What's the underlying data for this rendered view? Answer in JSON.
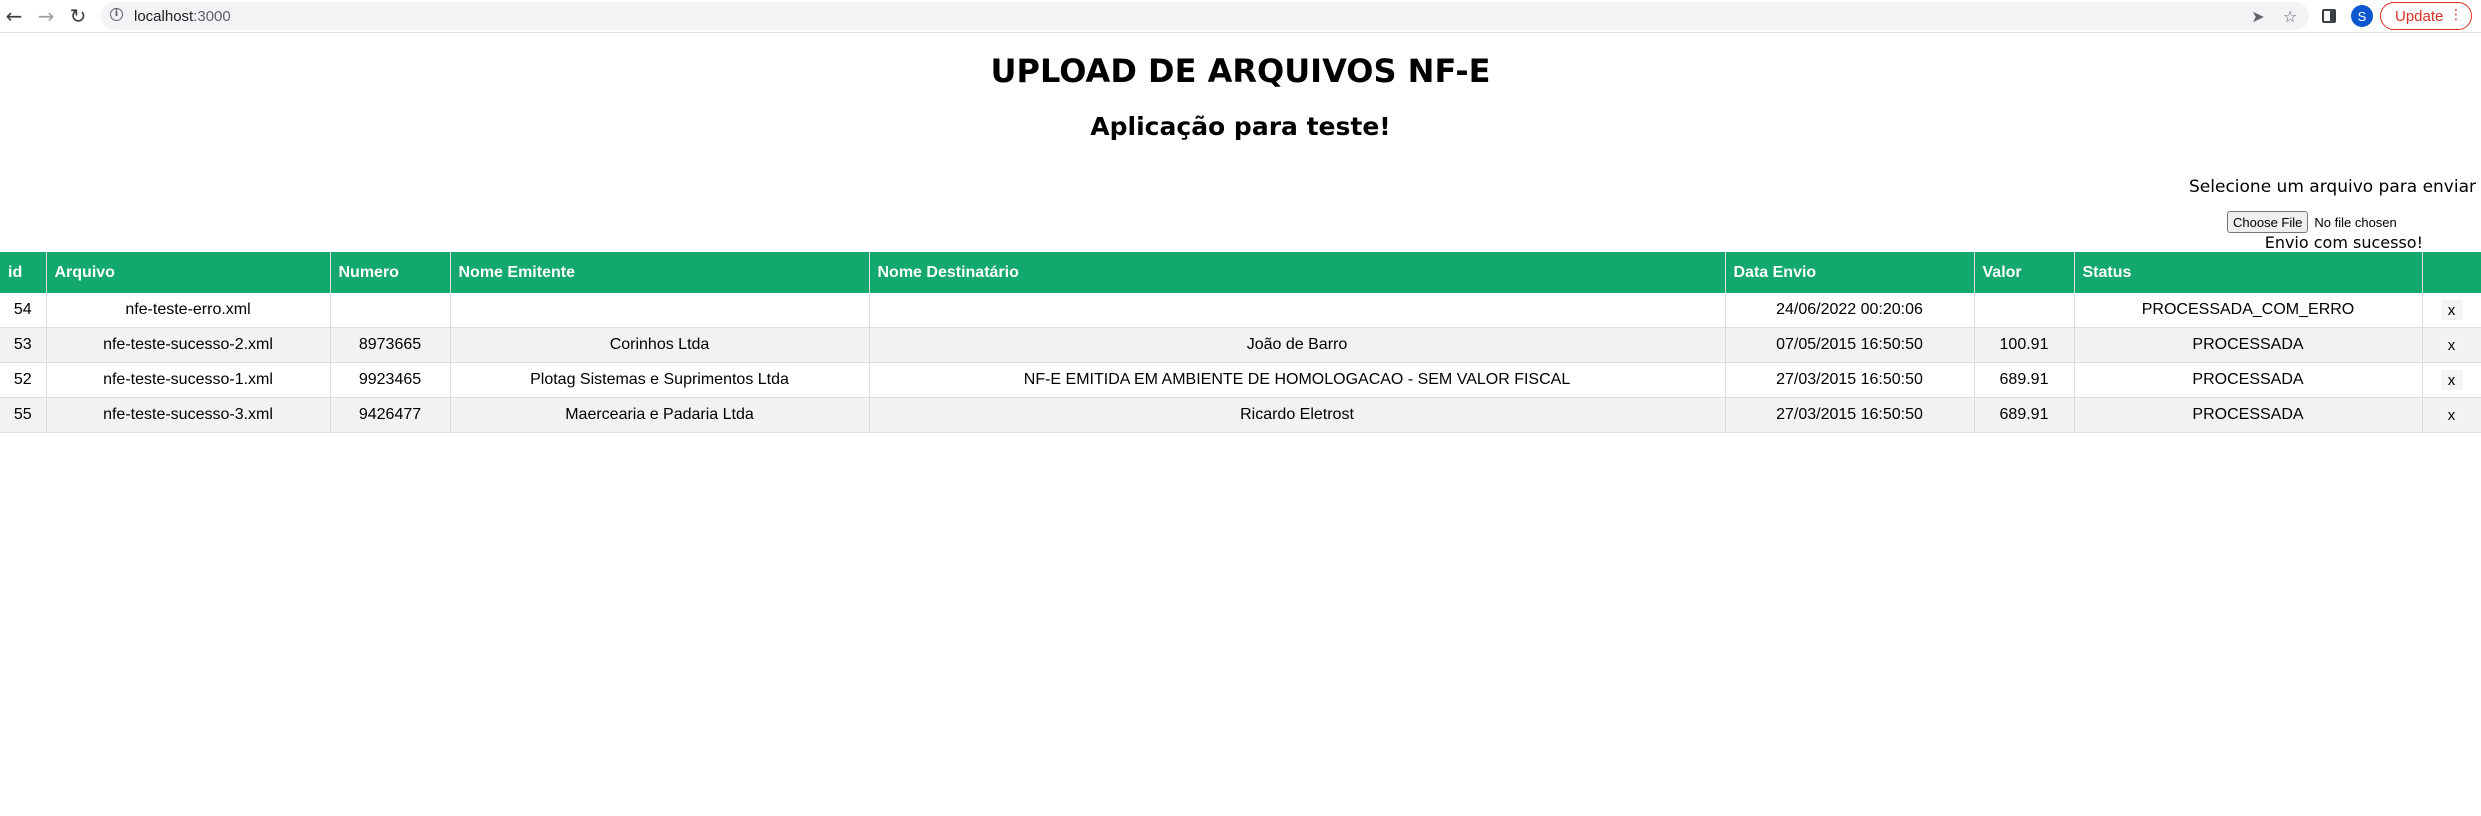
{
  "browser": {
    "url_host": "localhost",
    "url_port": ":3000",
    "profile_initial": "S",
    "update_label": "Update"
  },
  "page": {
    "title": "UPLOAD DE ARQUIVOS NF-E",
    "subtitle": "Aplicação para teste!"
  },
  "upload": {
    "label": "Selecione um arquivo para enviar",
    "button_label": "Choose File",
    "file_status": "No file chosen",
    "message": "Envio com sucesso!"
  },
  "table": {
    "headers": [
      "id",
      "Arquivo",
      "Numero",
      "Nome Emitente",
      "Nome Destinatário",
      "Data Envio",
      "Valor",
      "Status",
      ""
    ],
    "rows": [
      {
        "id": "54",
        "arquivo": "nfe-teste-erro.xml",
        "numero": "",
        "emitente": "",
        "destinatario": "",
        "data_envio": "24/06/2022 00:20:06",
        "valor": "",
        "status": "PROCESSADA_COM_ERRO",
        "action": "x"
      },
      {
        "id": "53",
        "arquivo": "nfe-teste-sucesso-2.xml",
        "numero": "8973665",
        "emitente": "Corinhos Ltda",
        "destinatario": "João de Barro",
        "data_envio": "07/05/2015 16:50:50",
        "valor": "100.91",
        "status": "PROCESSADA",
        "action": "x"
      },
      {
        "id": "52",
        "arquivo": "nfe-teste-sucesso-1.xml",
        "numero": "9923465",
        "emitente": "Plotag Sistemas e Suprimentos Ltda",
        "destinatario": "NF-E EMITIDA EM AMBIENTE DE HOMOLOGACAO - SEM VALOR FISCAL",
        "data_envio": "27/03/2015 16:50:50",
        "valor": "689.91",
        "status": "PROCESSADA",
        "action": "x"
      },
      {
        "id": "55",
        "arquivo": "nfe-teste-sucesso-3.xml",
        "numero": "9426477",
        "emitente": "Maercearia e Padaria Ltda",
        "destinatario": "Ricardo Eletrost",
        "data_envio": "27/03/2015 16:50:50",
        "valor": "689.91",
        "status": "PROCESSADA",
        "action": "x"
      }
    ]
  },
  "colors": {
    "header_bg": "#12a86e",
    "update_red": "#d93025"
  }
}
